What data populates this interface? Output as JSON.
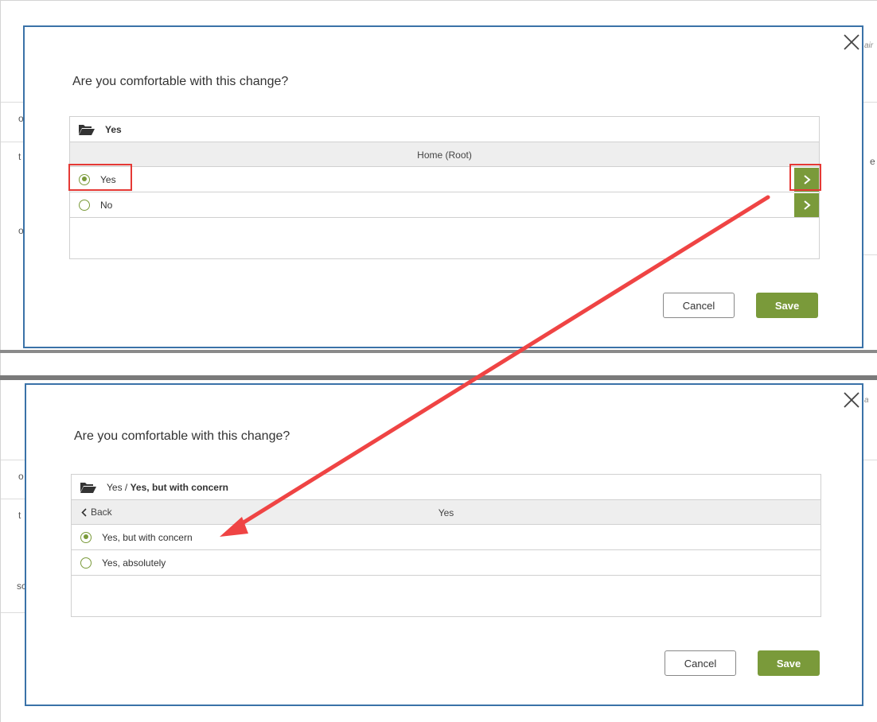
{
  "background": {
    "fragments": [
      "air",
      "o",
      "t",
      "o",
      "e",
      "a",
      "o",
      "t",
      "sc"
    ]
  },
  "top_dialog": {
    "question": "Are you comfortable with this change?",
    "path_label": "Yes",
    "header_label": "Home (Root)",
    "options": [
      {
        "label": "Yes",
        "checked": true
      },
      {
        "label": "No",
        "checked": false
      }
    ],
    "next_icon": "chevron-right-icon",
    "cancel_label": "Cancel",
    "save_label": "Save"
  },
  "bottom_dialog": {
    "question": "Are you comfortable with this change?",
    "path_parent": "Yes",
    "path_separator": " / ",
    "path_current": "Yes, but with concern",
    "back_label": "Back",
    "header_label": "Yes",
    "options": [
      {
        "label": "Yes, but with concern",
        "checked": true
      },
      {
        "label": "Yes, absolutely",
        "checked": false
      }
    ],
    "cancel_label": "Cancel",
    "save_label": "Save"
  },
  "annotation": {
    "highlight_color": "#e53935",
    "arrow_color": "#ef4444"
  },
  "colors": {
    "accent_green": "#7a9a3a",
    "dialog_border": "#3a72a8"
  }
}
